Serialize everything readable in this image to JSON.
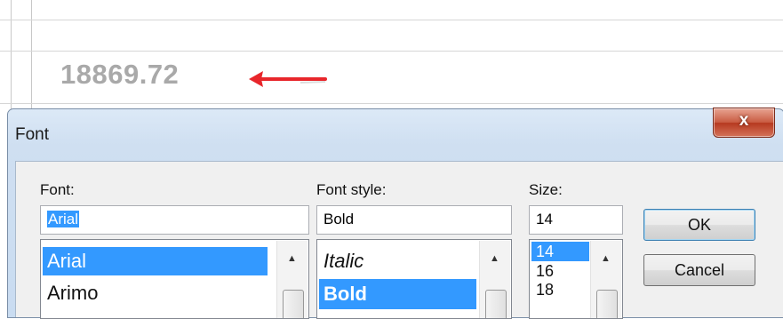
{
  "sheet": {
    "cell_value": "18869.72"
  },
  "dialog": {
    "title": "Font",
    "close_label": "x",
    "font_label": "Font:",
    "font_value": "Arial",
    "font_list": [
      "Arial",
      "Arimo"
    ],
    "style_label": "Font style:",
    "style_value": "Bold",
    "style_list": [
      "Italic",
      "Bold"
    ],
    "size_label": "Size:",
    "size_value": "14",
    "size_list": [
      "14",
      "16",
      "18"
    ],
    "ok_label": "OK",
    "cancel_label": "Cancel"
  },
  "colors": {
    "selection": "#3399ff",
    "arrow": "#e8262b",
    "cell_text": "#a9a9a9"
  }
}
